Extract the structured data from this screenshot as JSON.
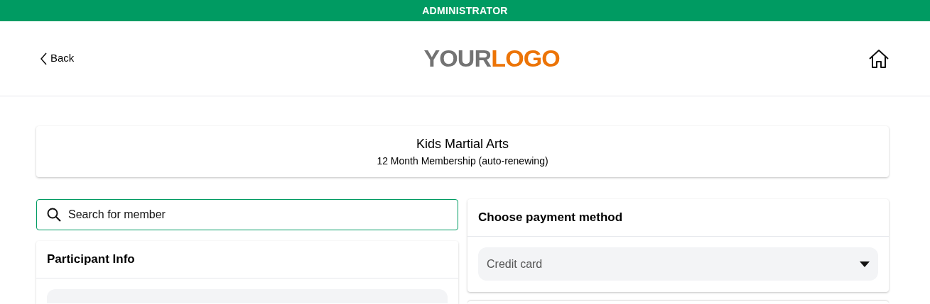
{
  "role_banner": "ADMINISTRATOR",
  "header": {
    "back": "Back",
    "logo": {
      "dark": "YOUR",
      "accent": "LOGO"
    }
  },
  "product": {
    "title": "Kids Martial Arts",
    "subtitle": "12 Month Membership (auto-renewing)"
  },
  "search": {
    "placeholder": "Search for member"
  },
  "participant_card": {
    "title": "Participant Info"
  },
  "payment_card": {
    "title": "Choose payment method",
    "select_value": "Credit card"
  }
}
